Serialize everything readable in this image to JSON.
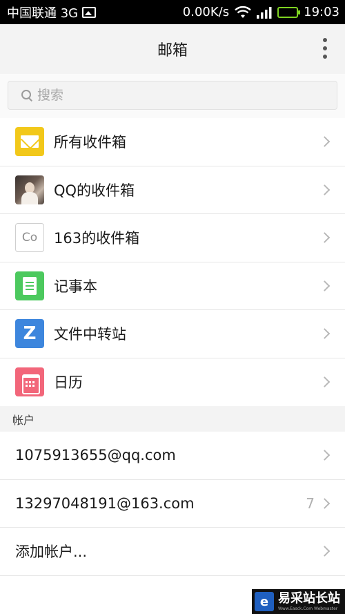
{
  "status_bar": {
    "carrier": "中国联通 3G",
    "speed": "0.00K/s",
    "time": "19:03",
    "icons": [
      "image-notification-icon",
      "wifi-icon",
      "signal-icon",
      "battery-icon"
    ]
  },
  "header": {
    "title": "邮箱",
    "menu_icon": "more-vertical-icon"
  },
  "search": {
    "placeholder": "搜索",
    "value": ""
  },
  "menu_items": [
    {
      "label": "所有收件箱",
      "icon": "mail-icon",
      "icon_color": "#f2c81a"
    },
    {
      "label": "QQ的收件箱",
      "icon": "avatar-photo-icon"
    },
    {
      "label": "163的收件箱",
      "icon": "co-icon",
      "icon_text": "Co"
    },
    {
      "label": "记事本",
      "icon": "notepad-icon",
      "icon_color": "#4cc95e"
    },
    {
      "label": "文件中转站",
      "icon": "file-transfer-icon",
      "icon_color": "#3d86dd"
    },
    {
      "label": "日历",
      "icon": "calendar-icon",
      "icon_color": "#f2667a"
    }
  ],
  "accounts": {
    "header": "帐户",
    "items": [
      {
        "email": "1075913655@qq.com",
        "count": ""
      },
      {
        "email": "13297048191@163.com",
        "count": "7"
      },
      {
        "email": "添加帐户...",
        "count": ""
      }
    ]
  },
  "watermark": {
    "logo_letter": "e",
    "text": "易采站长站",
    "subtext": "Www.Easck.Com Webmaster"
  },
  "colors": {
    "status_bar": "#000000",
    "app_bar": "#f3f3f3",
    "battery": "#7ed321",
    "chevron": "#b8b8b8"
  }
}
